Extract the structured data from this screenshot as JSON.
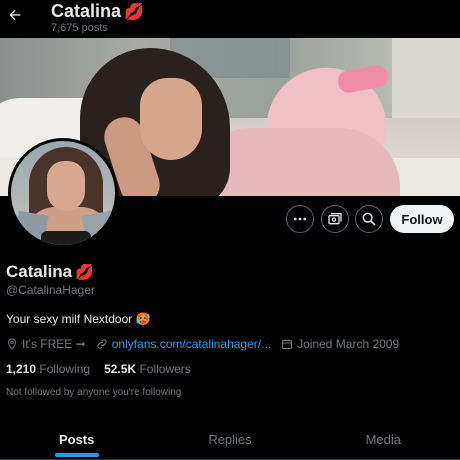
{
  "header": {
    "name": "Catalina",
    "name_emoji": "💋",
    "posts_count": "7,675 posts"
  },
  "profile": {
    "display_name": "Catalina",
    "display_emoji": "💋",
    "handle": "@CatalinaHager",
    "bio": "Your sexy milf Nextdoor 🥵",
    "location": "It's FREE ➞",
    "website": "onlyfans.com/catalinahager/...",
    "joined": "Joined March 2009",
    "following_count": "1,210",
    "following_label": "Following",
    "followers_count": "52.5K",
    "followers_label": "Followers",
    "not_followed_text": "Not followed by anyone you're following"
  },
  "actions": {
    "follow_label": "Follow"
  },
  "tabs": [
    {
      "label": "Posts",
      "active": true
    },
    {
      "label": "Replies",
      "active": false
    },
    {
      "label": "Media",
      "active": false
    }
  ],
  "icons": {
    "back": "arrow-left-icon",
    "more": "more-icon",
    "subscribe": "subscribe-icon",
    "search": "search-icon",
    "location": "location-icon",
    "link": "link-icon",
    "calendar": "calendar-icon"
  },
  "colors": {
    "background": "#000000",
    "primary_text": "#e7e9ea",
    "secondary_text": "#71767b",
    "accent": "#1d9bf0",
    "follow_button_bg": "#eff3f4"
  }
}
